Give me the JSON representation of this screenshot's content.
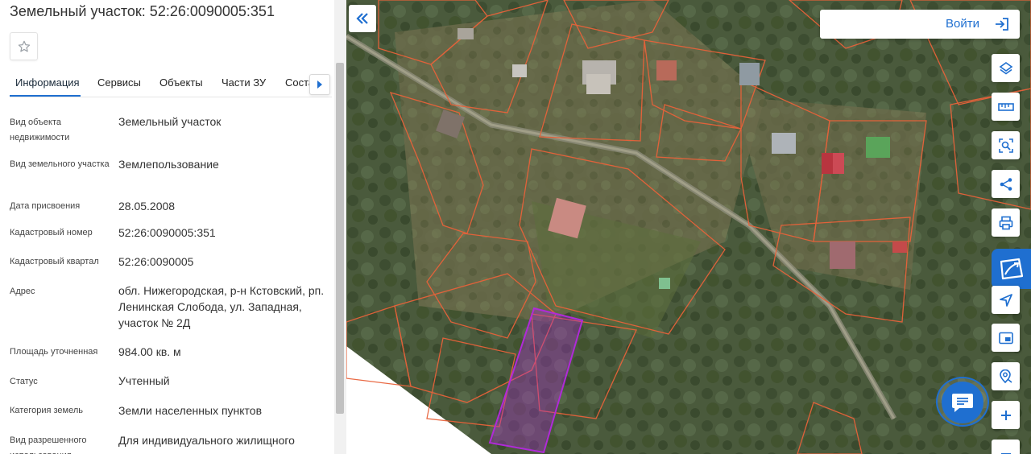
{
  "title": "Земельный участок: 52:26:0090005:351",
  "tabs": [
    {
      "label": "Информация"
    },
    {
      "label": "Сервисы"
    },
    {
      "label": "Объекты"
    },
    {
      "label": "Части ЗУ"
    },
    {
      "label": "Соста"
    }
  ],
  "rows": [
    {
      "label": "Вид объекта недвижимости",
      "value": "Земельный участок"
    },
    {
      "label": "Вид земельного участка",
      "value": "Землепользование"
    },
    {
      "label": "Дата присвоения",
      "value": "28.05.2008"
    },
    {
      "label": "Кадастровый номер",
      "value": "52:26:0090005:351"
    },
    {
      "label": "Кадастровый квартал",
      "value": "52:26:0090005"
    },
    {
      "label": "Адрес",
      "value": "обл. Нижегородская, р-н Кстовский, рп. Ленинская Слобода, ул. Западная, участок № 2Д"
    },
    {
      "label": "Площадь уточненная",
      "value": "984.00 кв. м"
    },
    {
      "label": "Статус",
      "value": "Учтенный"
    },
    {
      "label": "Категория земель",
      "value": "Земли населенных пунктов"
    },
    {
      "label": "Вид разрешенного использования",
      "value": "Для индивидуального жилищного строительства"
    }
  ],
  "header": {
    "login_label": "Войти"
  },
  "tools": [
    "layers-icon",
    "ruler-icon",
    "area-select-icon",
    "share-icon",
    "print-icon",
    "cadastre-icon",
    "locate-icon",
    "minimap-icon",
    "search-location-icon",
    "zoom-in-icon",
    "zoom-out-icon"
  ],
  "colors": {
    "accent": "#1f6fd0",
    "parcel_border": "#e8623a",
    "selected_parcel": "#b02ad8"
  }
}
